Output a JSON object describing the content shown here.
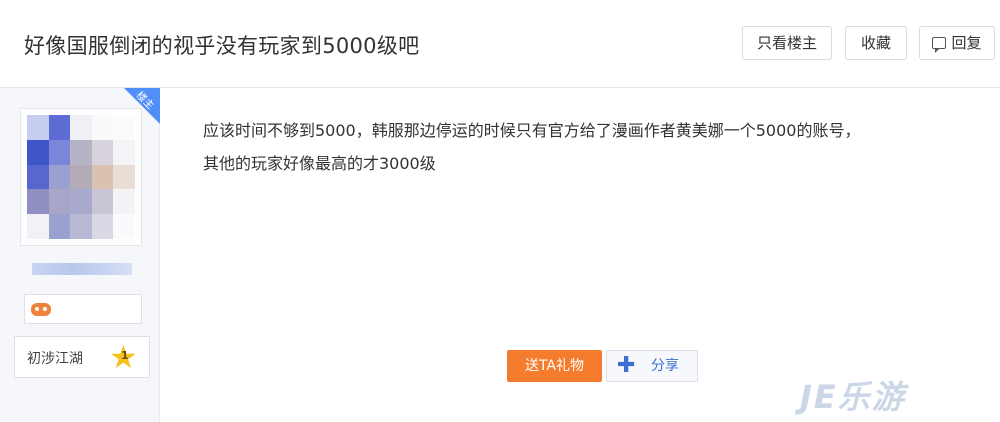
{
  "thread": {
    "title": "好像国服倒闭的视乎没有玩家到5000级吧",
    "buttons": {
      "only_op": "只看楼主",
      "collect": "收藏",
      "reply": "回复"
    }
  },
  "author": {
    "op_badge": "楼主",
    "level_name": "初涉江湖",
    "level_number": "1"
  },
  "post": {
    "line1": "应该时间不够到5000，韩服那边停运的时候只有官方给了漫画作者黄美娜一个5000的账号，",
    "line2": "其他的玩家好像最高的才3000级",
    "gift_label": "送TA礼物",
    "share_label": "分享"
  },
  "watermark": "JE乐游",
  "colors": {
    "accent_blue": "#4f8ff7",
    "gift_orange": "#f57c2c"
  }
}
